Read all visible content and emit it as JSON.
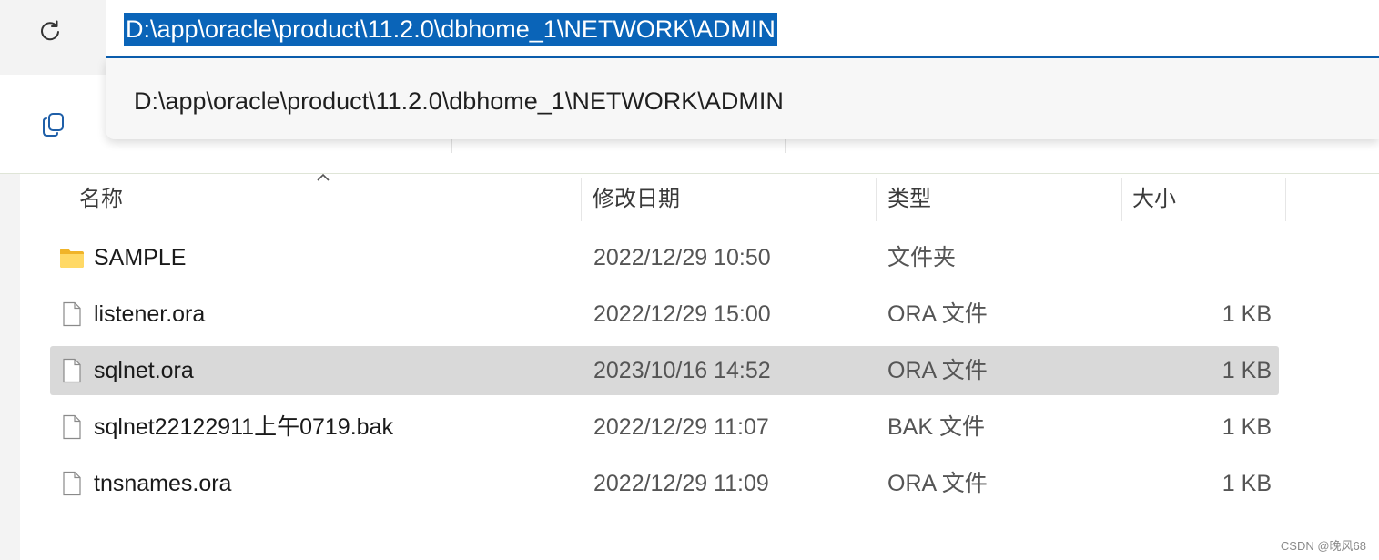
{
  "address_bar": {
    "value": "D:\\app\\oracle\\product\\11.2.0\\dbhome_1\\NETWORK\\ADMIN",
    "suggestion": "D:\\app\\oracle\\product\\11.2.0\\dbhome_1\\NETWORK\\ADMIN"
  },
  "columns": {
    "name": "名称",
    "date": "修改日期",
    "type": "类型",
    "size": "大小"
  },
  "files": [
    {
      "icon": "folder-icon",
      "name": "SAMPLE",
      "date": "2022/12/29 10:50",
      "type": "文件夹",
      "size": ""
    },
    {
      "icon": "file-icon",
      "name": "listener.ora",
      "date": "2022/12/29 15:00",
      "type": "ORA 文件",
      "size": "1 KB"
    },
    {
      "icon": "file-icon",
      "name": "sqlnet.ora",
      "date": "2023/10/16 14:52",
      "type": "ORA 文件",
      "size": "1 KB",
      "selected": true
    },
    {
      "icon": "file-icon",
      "name": "sqlnet22122911上午0719.bak",
      "date": "2022/12/29 11:07",
      "type": "BAK 文件",
      "size": "1 KB"
    },
    {
      "icon": "file-icon",
      "name": "tnsnames.ora",
      "date": "2022/12/29 11:09",
      "type": "ORA 文件",
      "size": "1 KB"
    }
  ],
  "watermark": "CSDN @晚风68",
  "colors": {
    "selection_highlight": "#0a64b8",
    "selected_row": "#d9d9d9",
    "folder": "#f4c542"
  }
}
